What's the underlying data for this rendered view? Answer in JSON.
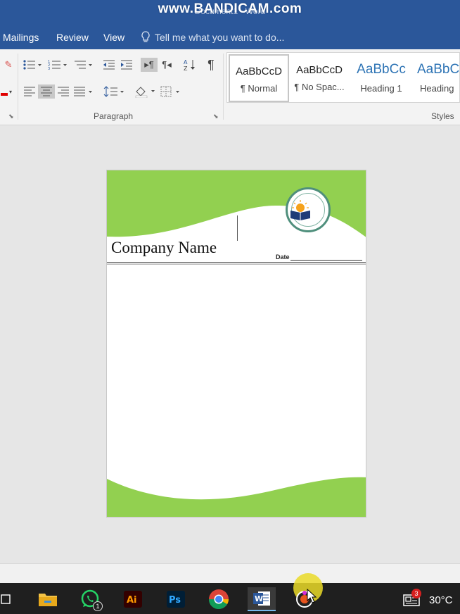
{
  "window": {
    "doc_title": "Document1 - Word",
    "watermark": "www.BANDICAM.com"
  },
  "tabs": [
    {
      "label": "Mailings"
    },
    {
      "label": "Review"
    },
    {
      "label": "View"
    }
  ],
  "tell_me": {
    "placeholder": "Tell me what you want to do..."
  },
  "ribbon": {
    "paragraph_group_label": "Paragraph",
    "styles_group_label": "Styles",
    "styles": [
      {
        "sample": "AaBbCcD",
        "name": "¶ Normal"
      },
      {
        "sample": "AaBbCcD",
        "name": "¶ No Spac..."
      },
      {
        "sample": "AaBbCc",
        "name": "Heading 1"
      },
      {
        "sample": "AaBbCc",
        "name": "Heading"
      }
    ]
  },
  "document": {
    "company_name": "Company Name",
    "date_label": "Date",
    "colors": {
      "accent_green": "#92d050",
      "rule": "#8c8c8c"
    }
  },
  "taskbar": {
    "whatsapp_badge": "1",
    "news_badge": "3",
    "temperature": "30°C",
    "apps": [
      "task-view",
      "file-explorer",
      "whatsapp",
      "illustrator",
      "photoshop",
      "chrome",
      "word",
      "recorder"
    ]
  },
  "colors": {
    "word_blue": "#2b579a",
    "taskbar": "#1f1f1f"
  }
}
